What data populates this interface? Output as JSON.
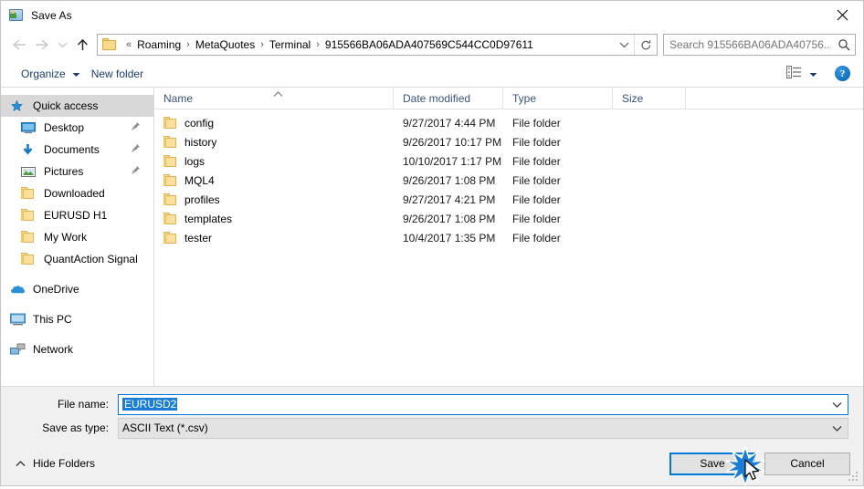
{
  "window": {
    "title": "Save As",
    "icon": "save-as-app-icon",
    "close_label": "✕"
  },
  "nav": {
    "back": "←",
    "forward": "→",
    "recent": "⌄",
    "up": "↑",
    "breadcrumb_prefix": "«",
    "breadcrumbs": [
      "Roaming",
      "MetaQuotes",
      "Terminal",
      "915566BA06ADA407569C544CC0D97611"
    ],
    "separator": "›",
    "refresh_icon": "refresh-icon",
    "dropdown_icon": "chevron-down-icon"
  },
  "search": {
    "placeholder": "Search 915566BA06ADA40756...",
    "value": "",
    "icon": "search-icon"
  },
  "toolbar": {
    "organize_label": "Organize",
    "new_folder_label": "New folder",
    "view_icon": "view-layout-icon",
    "view_caret": "chevron-down-icon",
    "help_label": "?"
  },
  "sidebar": {
    "groups": [
      {
        "items": [
          {
            "label": "Quick access",
            "icon": "star-icon",
            "selected": true,
            "pinned": false,
            "root": true
          },
          {
            "label": "Desktop",
            "icon": "desktop-icon",
            "selected": false,
            "pinned": true,
            "root": false
          },
          {
            "label": "Documents",
            "icon": "documents-icon",
            "selected": false,
            "pinned": true,
            "root": false
          },
          {
            "label": "Pictures",
            "icon": "pictures-icon",
            "selected": false,
            "pinned": true,
            "root": false
          },
          {
            "label": "Downloaded",
            "icon": "folder-icon",
            "selected": false,
            "pinned": false,
            "root": false
          },
          {
            "label": "EURUSD H1",
            "icon": "folder-icon",
            "selected": false,
            "pinned": false,
            "root": false
          },
          {
            "label": "My Work",
            "icon": "folder-icon",
            "selected": false,
            "pinned": false,
            "root": false
          },
          {
            "label": "QuantAction Signal",
            "icon": "folder-icon",
            "selected": false,
            "pinned": false,
            "root": false
          }
        ]
      },
      {
        "items": [
          {
            "label": "OneDrive",
            "icon": "onedrive-cloud-icon",
            "selected": false,
            "pinned": false,
            "root": true
          }
        ]
      },
      {
        "items": [
          {
            "label": "This PC",
            "icon": "this-pc-icon",
            "selected": false,
            "pinned": false,
            "root": true
          }
        ]
      },
      {
        "items": [
          {
            "label": "Network",
            "icon": "network-icon",
            "selected": false,
            "pinned": false,
            "root": true
          }
        ]
      }
    ]
  },
  "filelist": {
    "columns": [
      "Name",
      "Date modified",
      "Type",
      "Size"
    ],
    "sort_column": "Name",
    "sort_direction": "ascending",
    "rows": [
      {
        "name": "config",
        "date": "9/27/2017 4:44 PM",
        "type": "File folder",
        "size": ""
      },
      {
        "name": "history",
        "date": "9/26/2017 10:17 PM",
        "type": "File folder",
        "size": ""
      },
      {
        "name": "logs",
        "date": "10/10/2017 1:17 PM",
        "type": "File folder",
        "size": ""
      },
      {
        "name": "MQL4",
        "date": "9/26/2017 1:08 PM",
        "type": "File folder",
        "size": ""
      },
      {
        "name": "profiles",
        "date": "9/27/2017 4:21 PM",
        "type": "File folder",
        "size": ""
      },
      {
        "name": "templates",
        "date": "9/26/2017 1:08 PM",
        "type": "File folder",
        "size": ""
      },
      {
        "name": "tester",
        "date": "10/4/2017 1:35 PM",
        "type": "File folder",
        "size": ""
      }
    ]
  },
  "form": {
    "filename_label": "File name:",
    "filename_value": "EURUSD2",
    "filetype_label": "Save as type:",
    "filetype_value": "ASCII Text (*.csv)"
  },
  "footer": {
    "hide_folders_label": "Hide Folders",
    "save_label": "Save",
    "cancel_label": "Cancel"
  },
  "colors": {
    "accent": "#0078d7",
    "selection": "#1a7fd4",
    "breadcrumb_text": "#000000",
    "toolbar_text": "#1b3d6e",
    "column_header_text": "#3a527b",
    "folder_fill": "#fcdf9a",
    "folder_border": "#e0b254",
    "form_background": "#f0f0f0"
  }
}
